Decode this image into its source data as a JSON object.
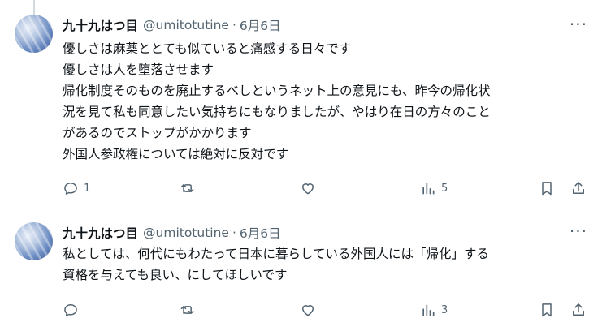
{
  "tweets": [
    {
      "author_name": "九十九はつ目",
      "handle": "@umitotutine",
      "separator": "·",
      "date": "6月6日",
      "more": "···",
      "lines": [
        "優しさは麻薬ととても似ていると痛感する日々です",
        "優しさは人を堕落させます",
        "帰化制度そのものを廃止するべしというネット上の意見にも、昨今の帰化状",
        "況を見て私も同意したい気持ちにもなりましたが、やはり在日の方々のこと",
        "があるのでストップがかかります",
        "外国人参政権については絶対に反対です"
      ],
      "reply_count": "1",
      "retweet_count": "",
      "like_count": "",
      "view_count": "5"
    },
    {
      "author_name": "九十九はつ目",
      "handle": "@umitotutine",
      "separator": "·",
      "date": "6月6日",
      "more": "···",
      "lines": [
        "私としては、何代にもわたって日本に暮らしている外国人には「帰化」する",
        "資格を与えても良い、にしてほしいです"
      ],
      "reply_count": "",
      "retweet_count": "",
      "like_count": "",
      "view_count": "3"
    }
  ],
  "icons": {
    "reply": "reply-icon",
    "retweet": "retweet-icon",
    "like": "heart-icon",
    "views": "views-icon",
    "bookmark": "bookmark-icon",
    "share": "share-icon"
  },
  "colors": {
    "text": "#0f1419",
    "secondary": "#536471",
    "thread_line": "#cfd9de"
  }
}
